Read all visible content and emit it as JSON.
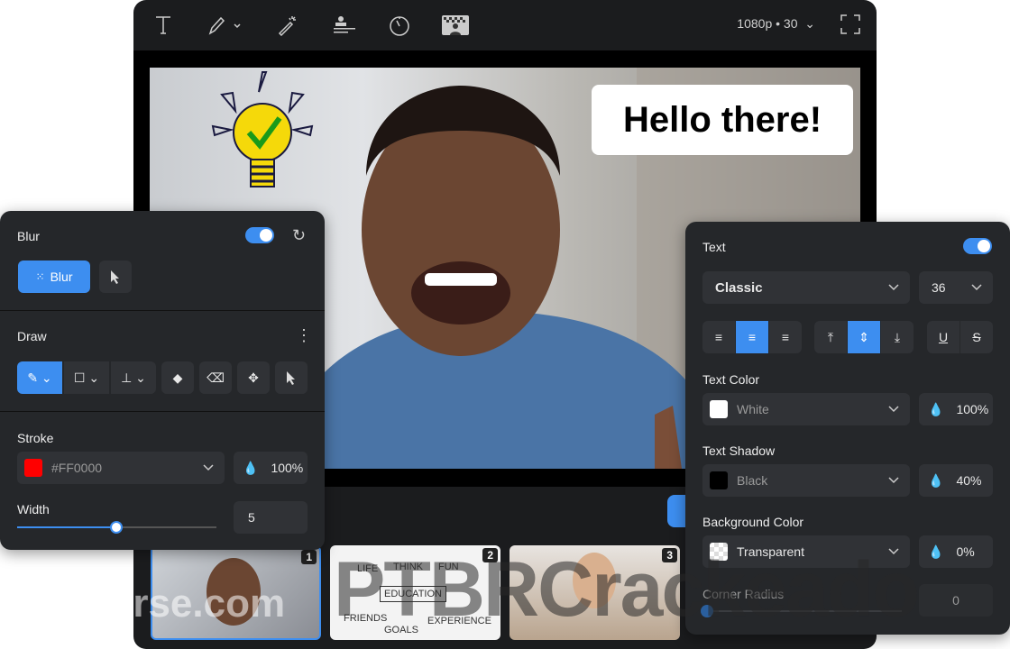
{
  "toolbar": {
    "tools": [
      "text-icon",
      "pen-icon",
      "magic-wand-icon",
      "stamp-icon",
      "timer-icon",
      "background-icon"
    ],
    "resolution": "1080p • 30"
  },
  "video": {
    "caption": "Hello there!"
  },
  "thumbnails": [
    {
      "num": "1",
      "selected": true
    },
    {
      "num": "2",
      "words": [
        "LIFE",
        "THINK",
        "FUN",
        "EDUCATION",
        "FRIENDS",
        "GOALS",
        "EXPERIENCE"
      ]
    },
    {
      "num": "3"
    }
  ],
  "blur_panel": {
    "title": "Blur",
    "enabled": true,
    "blur_button": "Blur"
  },
  "draw_panel": {
    "title": "Draw",
    "tools": [
      "pen",
      "rectangle",
      "stamp",
      "fill",
      "eraser",
      "move",
      "select"
    ]
  },
  "stroke": {
    "label": "Stroke",
    "color": "#FF0000",
    "opacity": "100%",
    "width_label": "Width",
    "width": "5",
    "width_fraction": 0.5
  },
  "text_panel": {
    "title": "Text",
    "enabled": true,
    "font": "Classic",
    "size": "36",
    "align": "center",
    "valign": "middle",
    "text_color_label": "Text Color",
    "text_color": "White",
    "text_opacity": "100%",
    "shadow_label": "Text Shadow",
    "shadow_color": "Black",
    "shadow_opacity": "40%",
    "bg_label": "Background Color",
    "bg_color": "Transparent",
    "bg_opacity": "0%",
    "radius_label": "Corner Radius",
    "radius": "0",
    "radius_fraction": 0
  },
  "colors": {
    "accent": "#3d8ef0",
    "panel": "#25272a",
    "window": "#1b1c1e"
  },
  "watermarks": [
    "filehorse.com",
    "PTBRCrackeado"
  ]
}
